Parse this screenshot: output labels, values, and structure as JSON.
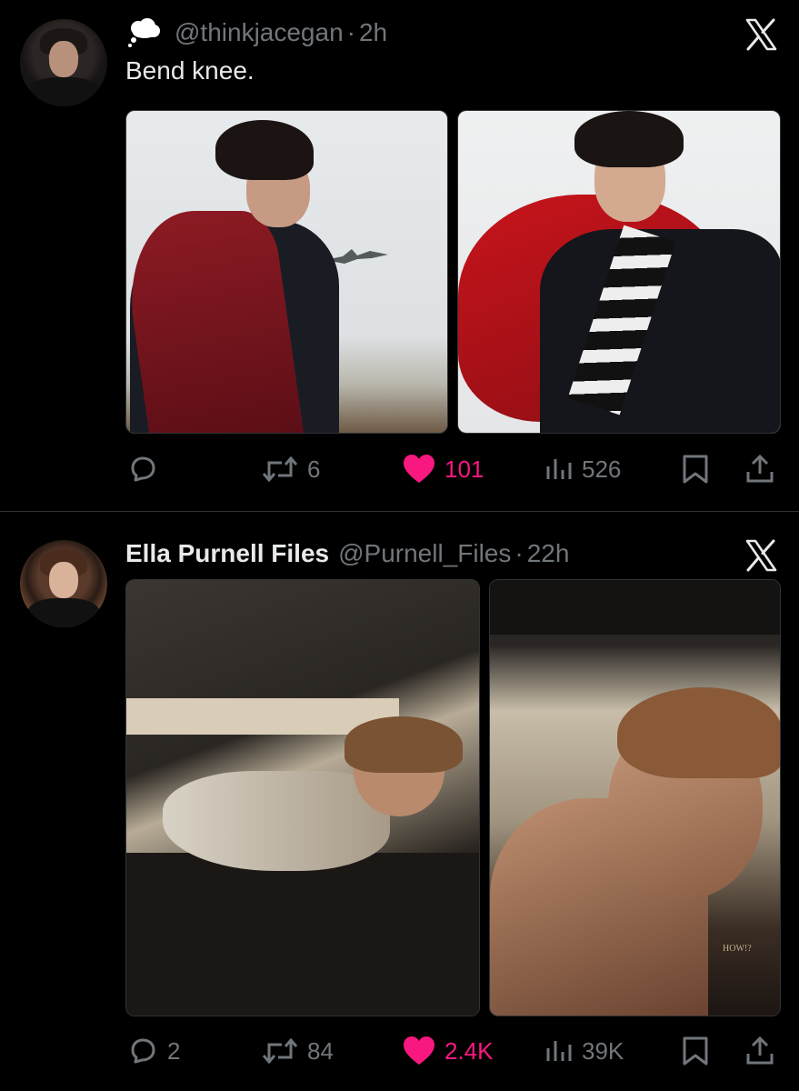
{
  "tweets": [
    {
      "name": "",
      "handle": "@thinkjacegan",
      "separator": "·",
      "time": "2h",
      "text": "Bend knee.",
      "stats": {
        "replies": "",
        "retweets": "6",
        "likes": "101",
        "views": "526"
      },
      "liked": true,
      "media_count": 2,
      "icons": [
        "thought-cloud-icon",
        "x-logo-icon",
        "reply-icon",
        "retweet-icon",
        "heart-icon",
        "views-icon",
        "bookmark-icon",
        "share-icon"
      ]
    },
    {
      "name": "Ella Purnell Files",
      "handle": "@Purnell_Files",
      "separator": "·",
      "time": "22h",
      "text": "",
      "stats": {
        "replies": "2",
        "retweets": "84",
        "likes": "2.4K",
        "views": "39K"
      },
      "liked": true,
      "media_count": 2,
      "media_watermark": "HOW!?",
      "icons": [
        "x-logo-icon",
        "reply-icon",
        "retweet-icon",
        "heart-icon",
        "views-icon",
        "bookmark-icon",
        "share-icon"
      ]
    }
  ],
  "colors": {
    "background": "#000000",
    "text": "#e7e9ea",
    "muted": "#71767b",
    "like": "#f91880",
    "divider": "#2f3336"
  }
}
